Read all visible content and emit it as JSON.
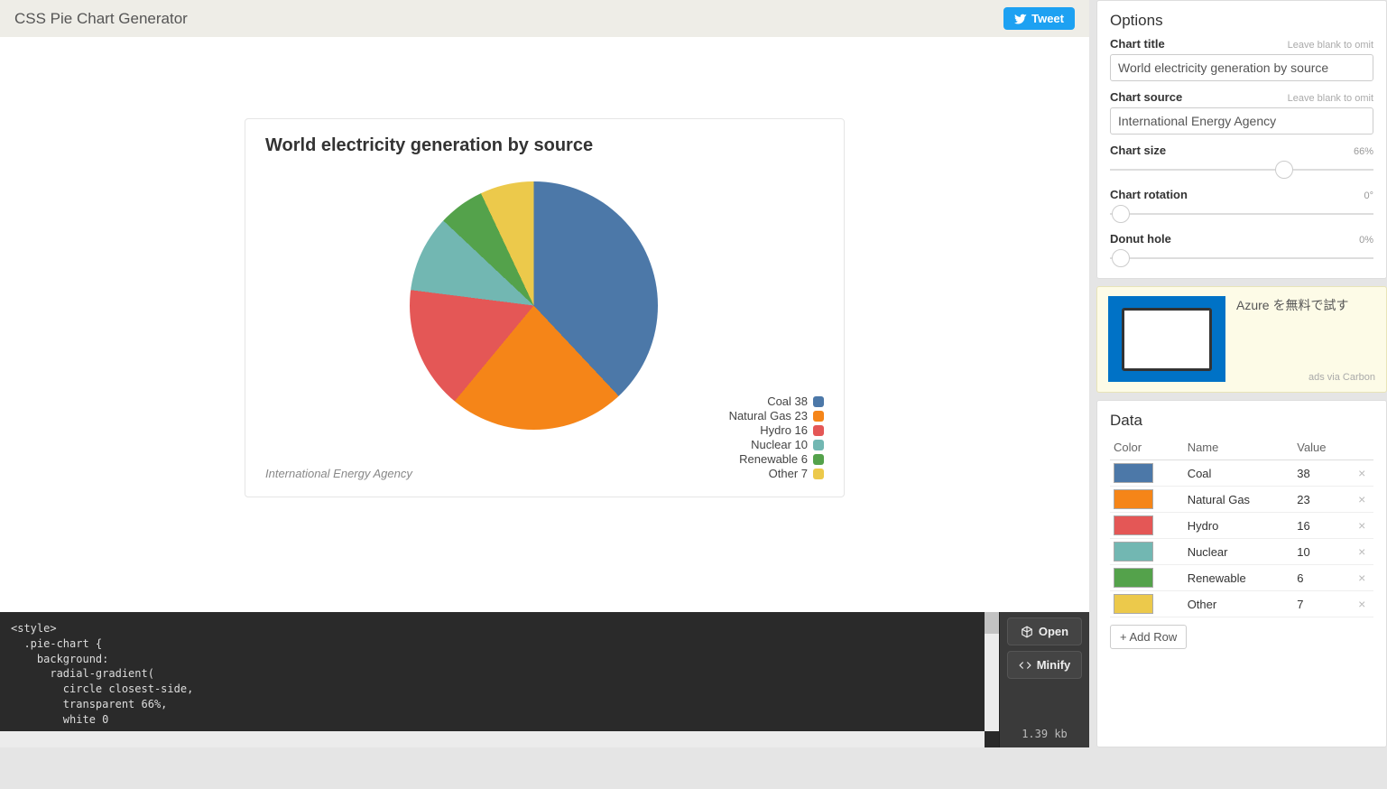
{
  "header": {
    "title": "CSS Pie Chart Generator",
    "tweet": "Tweet"
  },
  "chart_data": {
    "type": "pie",
    "title": "World electricity generation by source",
    "source": "International Energy Agency",
    "series": [
      {
        "name": "Coal",
        "value": 38,
        "color": "#4c78a8"
      },
      {
        "name": "Natural Gas",
        "value": 23,
        "color": "#f58518"
      },
      {
        "name": "Hydro",
        "value": 16,
        "color": "#e45756"
      },
      {
        "name": "Nuclear",
        "value": 10,
        "color": "#72b7b2"
      },
      {
        "name": "Renewable",
        "value": 6,
        "color": "#54a24b"
      },
      {
        "name": "Other",
        "value": 7,
        "color": "#ecc94b"
      }
    ]
  },
  "code": "<style>\n  .pie-chart {\n    background:\n      radial-gradient(\n        circle closest-side,\n        transparent 66%,\n        white 0\n      )",
  "codeButtons": {
    "open": "Open",
    "minify": "Minify",
    "size": "1.39 kb"
  },
  "options": {
    "heading": "Options",
    "titleLabel": "Chart title",
    "titleHint": "Leave blank to omit",
    "sourceLabel": "Chart source",
    "sourceHint": "Leave blank to omit",
    "sizeLabel": "Chart size",
    "sizeVal": "66%",
    "sizePct": 66,
    "rotLabel": "Chart rotation",
    "rotVal": "0°",
    "rotPct": 0,
    "holeLabel": "Donut hole",
    "holeVal": "0%",
    "holePct": 0
  },
  "ad": {
    "text": "Azure を無料で試す",
    "via": "ads via Carbon"
  },
  "data": {
    "heading": "Data",
    "cols": {
      "color": "Color",
      "name": "Name",
      "value": "Value"
    },
    "addRow": "+ Add Row"
  }
}
